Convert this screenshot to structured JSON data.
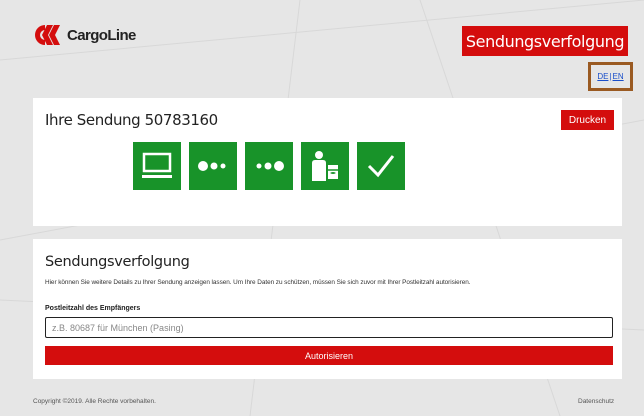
{
  "header": {
    "brand": "CargoLine",
    "title": "Sendungsverfolgung",
    "lang_de": "DE",
    "lang_sep": "|",
    "lang_en": "EN"
  },
  "shipment": {
    "title": "Ihre Sendung 50783160",
    "print_label": "Drucken",
    "steps": [
      {
        "icon": "monitor-icon"
      },
      {
        "icon": "dots-left-icon"
      },
      {
        "icon": "dots-right-icon"
      },
      {
        "icon": "delivery-person-icon"
      },
      {
        "icon": "checkmark-icon"
      }
    ]
  },
  "tracking": {
    "heading": "Sendungsverfolgung",
    "description": "Hier können Sie weitere Details zu Ihrer Sendung anzeigen lassen. Um Ihre Daten zu schützen, müssen Sie sich zuvor mit Ihrer Postleitzahl autorisieren.",
    "zip_label": "Postleitzahl des Empfängers",
    "zip_placeholder": "z.B. 80687 für München (Pasing)",
    "zip_value": "",
    "authorize_label": "Autorisieren"
  },
  "footer": {
    "copyright": "Copyright ©2019. Alle Rechte vorbehalten.",
    "privacy": "Datenschutz"
  },
  "colors": {
    "brand_red": "#d40d0d",
    "step_green": "#189329",
    "lang_highlight": "#9a5a22",
    "background": "#e6e6e6"
  }
}
